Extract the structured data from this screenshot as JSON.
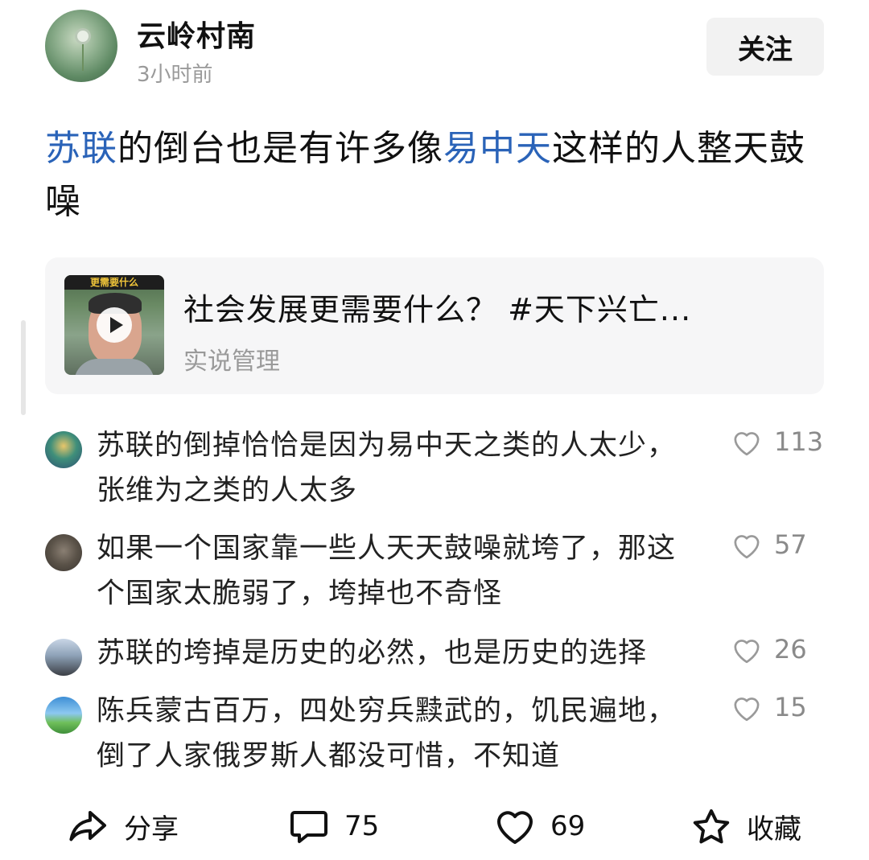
{
  "header": {
    "username": "云岭村南",
    "time": "3小时前",
    "follow_label": "关注"
  },
  "post": {
    "segments": [
      {
        "text": "苏联",
        "type": "link"
      },
      {
        "text": "的倒台也是有许多像",
        "type": "text"
      },
      {
        "text": "易中天",
        "type": "link"
      },
      {
        "text": "这样的人整天鼓噪",
        "type": "text"
      }
    ]
  },
  "card": {
    "title": "社会发展更需要什么？ #天下兴亡...",
    "source": "实说管理",
    "thumb_banner": "更需要什么",
    "play_icon": "play-icon"
  },
  "comments": [
    {
      "text": "苏联的倒掉恰恰是因为易中天之类的人太少，张维为之类的人太多",
      "likes": "113"
    },
    {
      "text": "如果一个国家靠一些人天天鼓噪就垮了，那这个国家太脆弱了，垮掉也不奇怪",
      "likes": "57"
    },
    {
      "text": "苏联的垮掉是历史的必然，也是历史的选择",
      "likes": "26"
    },
    {
      "text": "陈兵蒙古百万，四处穷兵黩武的，饥民遍地，倒了人家俄罗斯人都没可惜，不知道",
      "likes": "15"
    }
  ],
  "footer": {
    "share_label": "分享",
    "comment_count": "75",
    "like_count": "69",
    "collect_label": "收藏"
  },
  "colors": {
    "link": "#2a63b8",
    "muted": "#9a9a9a",
    "card_bg": "#f6f6f7",
    "button_bg": "#f2f2f2"
  }
}
